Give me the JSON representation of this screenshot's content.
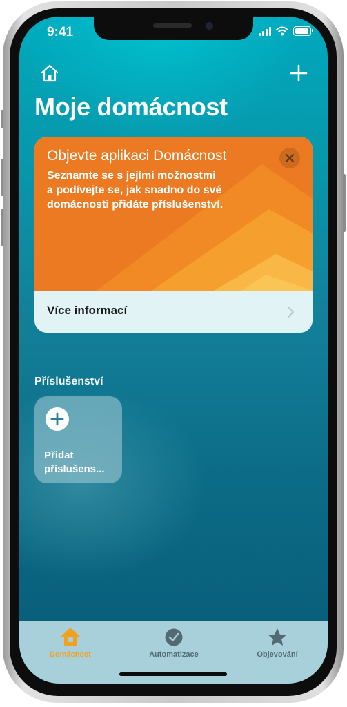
{
  "status_bar": {
    "time": "9:41"
  },
  "header": {
    "title": "Moje domácnost"
  },
  "promo_card": {
    "title": "Objevte aplikaci Domácnost",
    "text_lines": [
      "Seznamte se s jejími možnostmi",
      "a podívejte se, jak snadno do své",
      "domácnosti přidáte příslušenství."
    ],
    "link_label": "Více informací"
  },
  "accessories": {
    "section_label": "Příslušenství",
    "add_tile_lines": [
      "Přidat",
      "příslušens..."
    ]
  },
  "tab_bar": {
    "tabs": [
      {
        "label": "Domácnost",
        "icon": "house-icon",
        "active": true
      },
      {
        "label": "Automatizace",
        "icon": "clock-icon",
        "active": false
      },
      {
        "label": "Objevování",
        "icon": "star-icon",
        "active": false
      }
    ]
  },
  "colors": {
    "accent": "#f3a01c",
    "card_orange": "#ee7a1e",
    "background_teal": "#0d7c93"
  }
}
